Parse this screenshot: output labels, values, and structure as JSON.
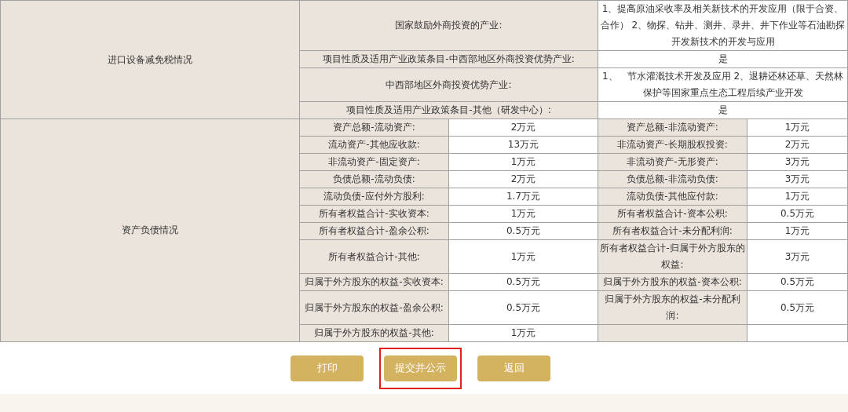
{
  "sections": [
    {
      "kind": "wide",
      "title": "进口设备减免税情况",
      "rows": [
        {
          "label": "国家鼓励外商投资的产业:",
          "value": "1、提高原油采收率及相关新技术的开发应用（限于合资、合作） 2、物探、钻井、测井、录井、井下作业等石油勘探开发新技术的开发与应用"
        },
        {
          "label": "项目性质及适用产业政策条目-中西部地区外商投资优势产业:",
          "value": "是"
        },
        {
          "label": "中西部地区外商投资优势产业:",
          "value": "1、　节水灌溉技术开发及应用 2、退耕还林还草、天然林保护等国家重点生态工程后续产业开发"
        },
        {
          "label": "项目性质及适用产业政策条目-其他（研发中心）:",
          "value": "是"
        }
      ]
    },
    {
      "kind": "pairs",
      "title": "资产负债情况",
      "rows": [
        {
          "cells": [
            {
              "label": "资产总额-流动资产:",
              "value": "2万元"
            },
            {
              "label": "资产总额-非流动资产:",
              "value": "1万元"
            }
          ]
        },
        {
          "cells": [
            {
              "label": "流动资产-其他应收款:",
              "value": "13万元"
            },
            {
              "label": "非流动资产-长期股权投资:",
              "value": "2万元"
            }
          ]
        },
        {
          "cells": [
            {
              "label": "非流动资产-固定资产:",
              "value": "1万元"
            },
            {
              "label": "非流动资产-无形资产:",
              "value": "3万元"
            }
          ]
        },
        {
          "cells": [
            {
              "label": "负债总额-流动负债:",
              "value": "2万元"
            },
            {
              "label": "负债总额-非流动负债:",
              "value": "3万元"
            }
          ]
        },
        {
          "cells": [
            {
              "label": "流动负债-应付外方股利:",
              "value": "1.7万元"
            },
            {
              "label": "流动负债-其他应付款:",
              "value": "1万元"
            }
          ]
        },
        {
          "cells": [
            {
              "label": "所有者权益合计-实收资本:",
              "value": "1万元"
            },
            {
              "label": "所有者权益合计-资本公积:",
              "value": "0.5万元"
            }
          ]
        },
        {
          "cells": [
            {
              "label": "所有者权益合计-盈余公积:",
              "value": "0.5万元"
            },
            {
              "label": "所有者权益合计-未分配利润:",
              "value": "1万元"
            }
          ]
        },
        {
          "cells": [
            {
              "label": "所有者权益合计-其他:",
              "value": "1万元"
            },
            {
              "label": "所有者权益合计-归属于外方股东的权益:",
              "value": "3万元"
            }
          ]
        },
        {
          "cells": [
            {
              "label": "归属于外方股东的权益-实收资本:",
              "value": "0.5万元"
            },
            {
              "label": "归属于外方股东的权益-资本公积:",
              "value": "0.5万元"
            }
          ]
        },
        {
          "cells": [
            {
              "label": "归属于外方股东的权益-盈余公积:",
              "value": "0.5万元"
            },
            {
              "label": "归属于外方股东的权益-未分配利润:",
              "value": "0.5万元"
            }
          ]
        },
        {
          "cells": [
            {
              "label": "归属于外方股东的权益-其他:",
              "value": "1万元"
            }
          ]
        }
      ]
    }
  ],
  "buttons": [
    {
      "label": "打印",
      "highlighted": false
    },
    {
      "label": "提交并公示",
      "highlighted": true
    },
    {
      "label": "返回",
      "highlighted": false
    }
  ]
}
